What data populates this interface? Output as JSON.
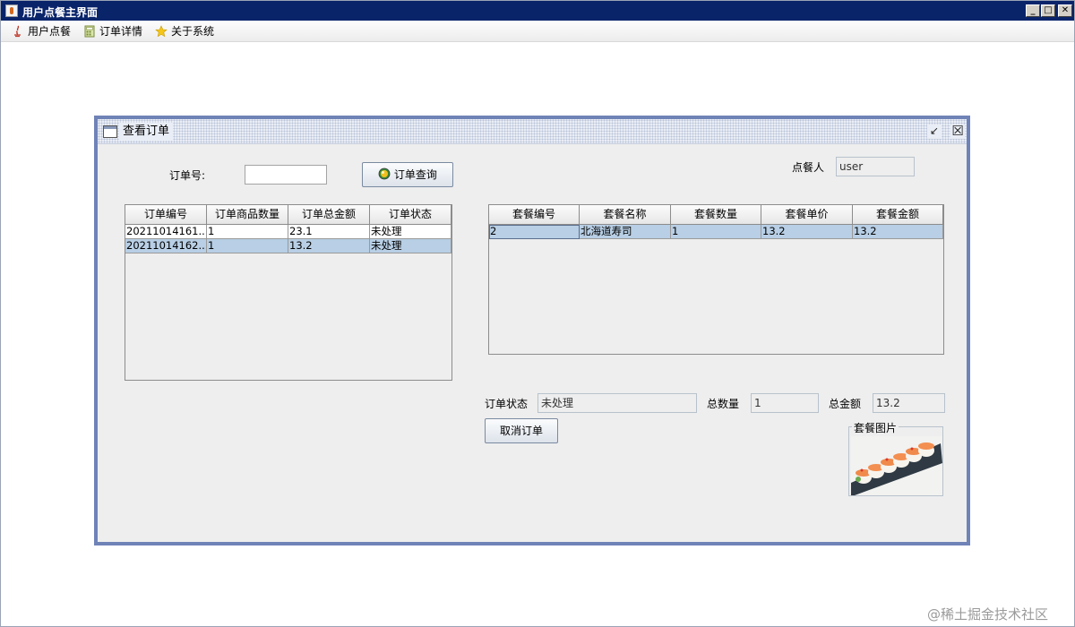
{
  "window": {
    "title": "用户点餐主界面",
    "min": "_",
    "max": "□",
    "close": "✕"
  },
  "menubar": {
    "items": [
      "用户点餐",
      "订单详情",
      "关于系统"
    ]
  },
  "frame": {
    "title": "查看订单",
    "restore": "↙",
    "close": "☒"
  },
  "form": {
    "order_no_label": "订单号:",
    "order_no_value": "",
    "query_button": "订单查询",
    "orderer_label": "点餐人",
    "orderer_value": "user"
  },
  "orders_table": {
    "columns": [
      "订单编号",
      "订单商品数量",
      "订单总金额",
      "订单状态"
    ],
    "rows": [
      [
        "20211014161...",
        "1",
        "23.1",
        "未处理"
      ],
      [
        "20211014162...",
        "1",
        "13.2",
        "未处理"
      ]
    ],
    "selected_row": 1
  },
  "items_table": {
    "columns": [
      "套餐编号",
      "套餐名称",
      "套餐数量",
      "套餐单价",
      "套餐金额"
    ],
    "rows": [
      [
        "2",
        "北海道寿司",
        "1",
        "13.2",
        "13.2"
      ]
    ],
    "selected_row": 0
  },
  "details": {
    "status_label": "订单状态",
    "status_value": "未处理",
    "qty_label": "总数量",
    "qty_value": "1",
    "total_label": "总金额",
    "total_value": "13.2",
    "cancel_button": "取消订单",
    "image_group_label": "套餐图片"
  },
  "watermark": "@稀土掘金技术社区"
}
